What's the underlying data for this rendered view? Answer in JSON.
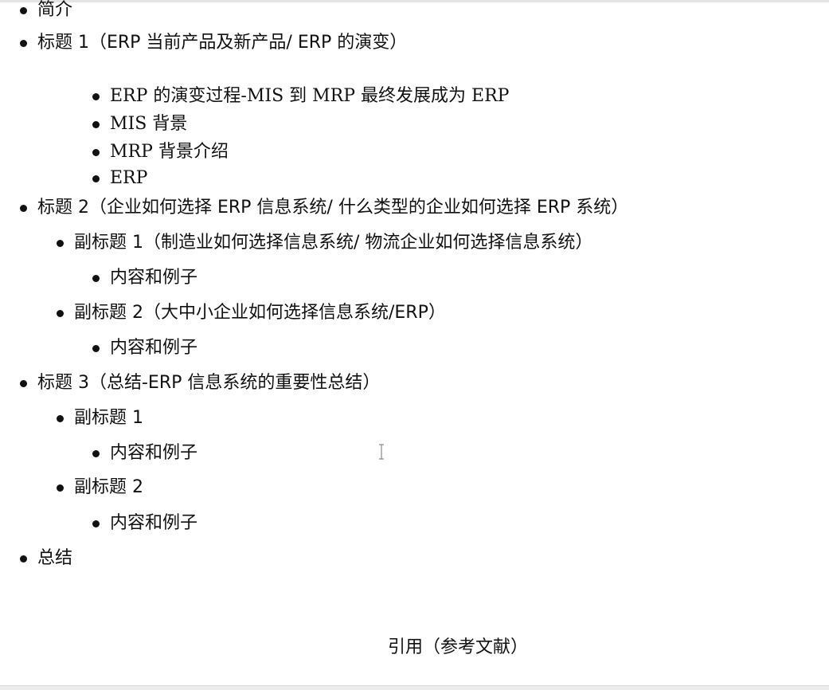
{
  "outline": {
    "intro": "简介",
    "heading1": "标题 1（ERP 当前产品及新产品/ ERP 的演变）",
    "heading1_items": [
      "ERP 的演变过程-MIS 到 MRP 最终发展成为 ERP",
      "MIS 背景",
      "MRP 背景介绍",
      "ERP"
    ],
    "heading2": "标题 2（企业如何选择 ERP 信息系统/ 什么类型的企业如何选择 ERP 系统）",
    "heading2_sub1": "副标题 1（制造业如何选择信息系统/ 物流企业如何选择信息系统）",
    "heading2_sub1_item": "内容和例子",
    "heading2_sub2": "副标题 2（大中小企业如何选择信息系统/ERP）",
    "heading2_sub2_item": "内容和例子",
    "heading3": "标题 3（总结-ERP 信息系统的重要性总结）",
    "heading3_sub1": "副标题 1",
    "heading3_sub1_item": "内容和例子",
    "heading3_sub2": "副标题 2",
    "heading3_sub2_item": "内容和例子",
    "summary": "总结"
  },
  "references_title": "引用（参考文献）",
  "colors": {
    "text": "#111111",
    "background": "#ffffff"
  },
  "icons": {
    "cursor": "text-cursor-icon",
    "bullet": "filled-circle-bullet-icon"
  }
}
